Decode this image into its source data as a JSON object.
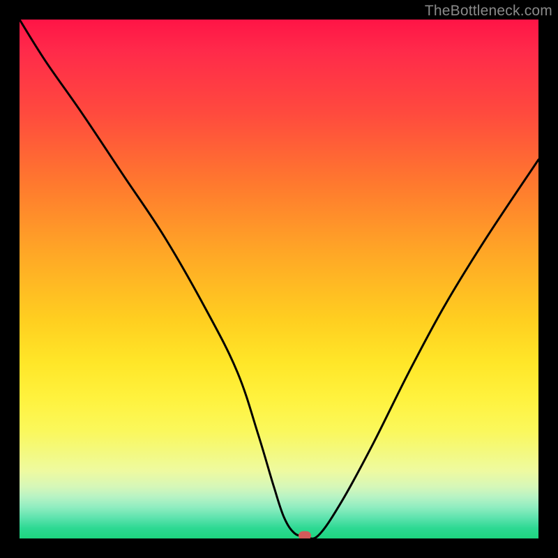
{
  "watermark": {
    "text": "TheBottleneck.com"
  },
  "chart_data": {
    "type": "line",
    "title": "",
    "xlabel": "",
    "ylabel": "",
    "xlim": [
      0,
      100
    ],
    "ylim": [
      0,
      100
    ],
    "grid": false,
    "legend": false,
    "series": [
      {
        "name": "bottleneck-curve",
        "x": [
          0,
          5,
          12,
          20,
          28,
          36,
          42,
          46,
          49,
          51,
          53,
          55,
          57.5,
          62,
          68,
          75,
          82,
          90,
          100
        ],
        "values": [
          100,
          92,
          82,
          70,
          58,
          44,
          32,
          20,
          10,
          4,
          1,
          0.5,
          0.5,
          7,
          18,
          32,
          45,
          58,
          73
        ]
      }
    ],
    "marker": {
      "x": 55,
      "y": 0.5,
      "name": "bottleneck-point"
    },
    "background_gradient": {
      "stops": [
        {
          "pos": 0.0,
          "color": "#ff1446"
        },
        {
          "pos": 0.5,
          "color": "#ffcf20"
        },
        {
          "pos": 0.78,
          "color": "#fbf85a"
        },
        {
          "pos": 1.0,
          "color": "#1ed67f"
        }
      ]
    }
  }
}
